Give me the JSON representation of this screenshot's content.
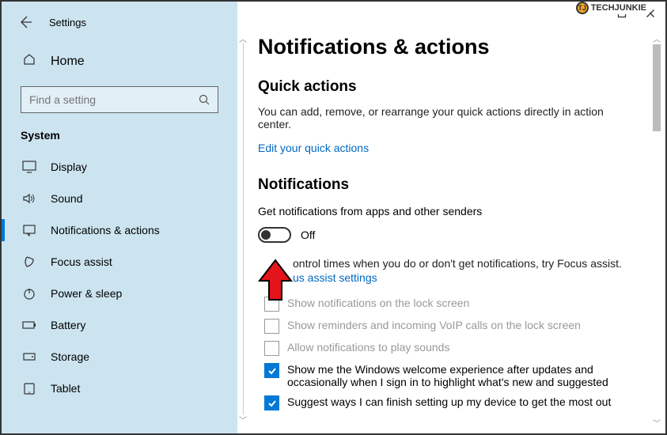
{
  "watermark": "TECHJUNKIE",
  "header": {
    "title": "Settings"
  },
  "sidebar": {
    "home": "Home",
    "search_placeholder": "Find a setting",
    "system_label": "System",
    "items": [
      {
        "label": "Display"
      },
      {
        "label": "Sound"
      },
      {
        "label": "Notifications & actions"
      },
      {
        "label": "Focus assist"
      },
      {
        "label": "Power & sleep"
      },
      {
        "label": "Battery"
      },
      {
        "label": "Storage"
      },
      {
        "label": "Tablet"
      }
    ]
  },
  "content": {
    "title": "Notifications & actions",
    "quick_actions": {
      "heading": "Quick actions",
      "desc": "You can add, remove, or rearrange your quick actions directly in action center.",
      "link": "Edit your quick actions"
    },
    "notifications": {
      "heading": "Notifications",
      "desc": "Get notifications from apps and other senders",
      "toggle_state": "Off",
      "focus_text": "ontrol times when you do or don't get notifications, try Focus assist.",
      "focus_link": "us assist settings",
      "checks": [
        {
          "label": "Show notifications on the lock screen",
          "checked": false,
          "disabled": true
        },
        {
          "label": "Show reminders and incoming VoIP calls on the lock screen",
          "checked": false,
          "disabled": true
        },
        {
          "label": "Allow notifications to play sounds",
          "checked": false,
          "disabled": true
        },
        {
          "label": "Show me the Windows welcome experience after updates and occasionally when I sign in to highlight what's new and suggested",
          "checked": true,
          "disabled": false
        },
        {
          "label": "Suggest ways I can finish setting up my device to get the most out",
          "checked": true,
          "disabled": false
        }
      ]
    }
  }
}
